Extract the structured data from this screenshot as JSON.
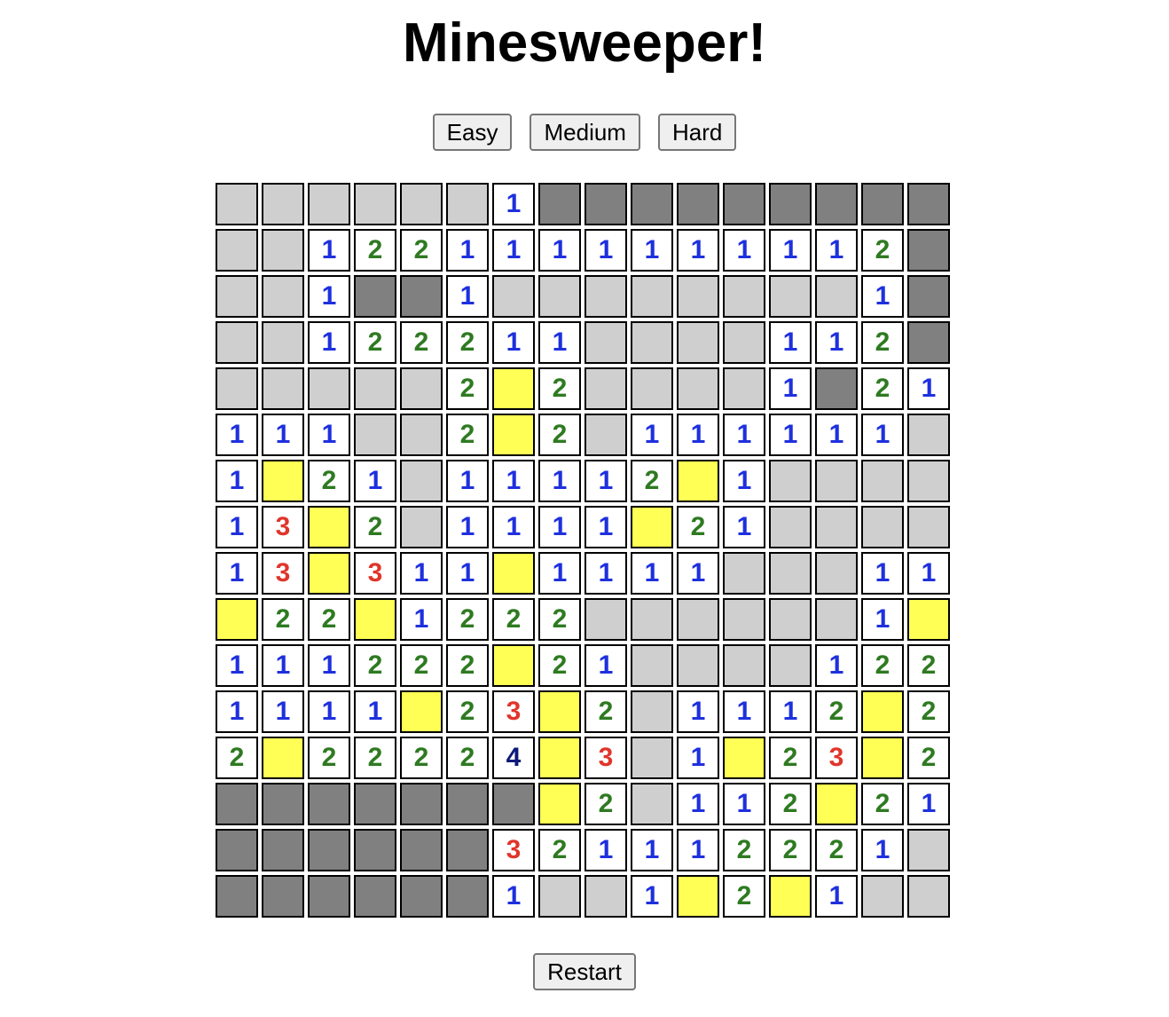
{
  "title": "Minesweeper!",
  "difficulty_buttons": [
    "Easy",
    "Medium",
    "Hard"
  ],
  "restart_label": "Restart",
  "colors": {
    "hidden": "#d0cfd0",
    "dark": "#808080",
    "open": "#ffffff",
    "flag": "#ffff55",
    "one": "#1e30dd",
    "two": "#2e7a21",
    "three": "#e0352b",
    "four": "#0c1a7a"
  },
  "legend": {
    "H": "hidden",
    "D": "dark",
    "Y": "flag",
    "0": "open-empty",
    "1-8": "open-number"
  },
  "board": [
    [
      "H",
      "H",
      "H",
      "H",
      "H",
      "H",
      "1",
      "D",
      "D",
      "D",
      "D",
      "D",
      "D",
      "D",
      "D",
      "D"
    ],
    [
      "H",
      "H",
      "1",
      "2",
      "2",
      "1",
      "1",
      "1",
      "1",
      "1",
      "1",
      "1",
      "1",
      "1",
      "2",
      "D"
    ],
    [
      "H",
      "H",
      "1",
      "D",
      "D",
      "1",
      "H",
      "H",
      "H",
      "H",
      "H",
      "H",
      "H",
      "H",
      "1",
      "D"
    ],
    [
      "H",
      "H",
      "1",
      "2",
      "2",
      "2",
      "1",
      "1",
      "H",
      "H",
      "H",
      "H",
      "1",
      "1",
      "2",
      "D"
    ],
    [
      "H",
      "H",
      "H",
      "H",
      "H",
      "2",
      "Y",
      "2",
      "H",
      "H",
      "H",
      "H",
      "1",
      "D",
      "2",
      "1"
    ],
    [
      "1",
      "1",
      "1",
      "H",
      "H",
      "2",
      "Y",
      "2",
      "H",
      "1",
      "1",
      "1",
      "1",
      "1",
      "1",
      "H"
    ],
    [
      "1",
      "Y",
      "2",
      "1",
      "H",
      "1",
      "1",
      "1",
      "1",
      "2",
      "Y",
      "1",
      "H",
      "H",
      "H",
      "H"
    ],
    [
      "1",
      "3",
      "Y",
      "2",
      "H",
      "1",
      "1",
      "1",
      "1",
      "Y",
      "2",
      "1",
      "H",
      "H",
      "H",
      "H"
    ],
    [
      "1",
      "3",
      "Y",
      "3",
      "1",
      "1",
      "Y",
      "1",
      "1",
      "1",
      "1",
      "H",
      "H",
      "H",
      "1",
      "1"
    ],
    [
      "Y",
      "2",
      "2",
      "Y",
      "1",
      "2",
      "2",
      "2",
      "H",
      "H",
      "H",
      "H",
      "H",
      "H",
      "1",
      "Y"
    ],
    [
      "1",
      "1",
      "1",
      "2",
      "2",
      "2",
      "Y",
      "2",
      "1",
      "H",
      "H",
      "H",
      "H",
      "1",
      "2",
      "2"
    ],
    [
      "1",
      "1",
      "1",
      "1",
      "Y",
      "2",
      "3",
      "Y",
      "2",
      "H",
      "1",
      "1",
      "1",
      "2",
      "Y",
      "2"
    ],
    [
      "2",
      "Y",
      "2",
      "2",
      "2",
      "2",
      "4",
      "Y",
      "3",
      "H",
      "1",
      "Y",
      "2",
      "3",
      "Y",
      "2"
    ],
    [
      "D",
      "D",
      "D",
      "D",
      "D",
      "D",
      "D",
      "Y",
      "2",
      "H",
      "1",
      "1",
      "2",
      "Y",
      "2",
      "1"
    ],
    [
      "D",
      "D",
      "D",
      "D",
      "D",
      "D",
      "3",
      "2",
      "1",
      "1",
      "1",
      "2",
      "2",
      "2",
      "1",
      "H"
    ],
    [
      "D",
      "D",
      "D",
      "D",
      "D",
      "D",
      "1",
      "H",
      "H",
      "1",
      "Y",
      "2",
      "Y",
      "1",
      "H",
      "H"
    ]
  ]
}
